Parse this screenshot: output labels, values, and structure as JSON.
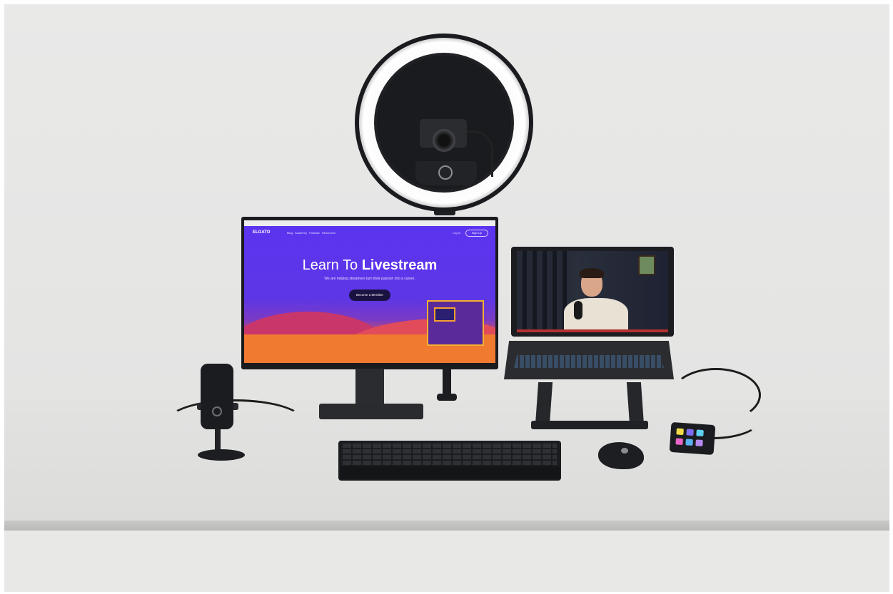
{
  "scene": {
    "description_free": true
  },
  "monitor_site": {
    "logo": "ELGATO",
    "nav": [
      "Blog",
      "Academy",
      "Podcast",
      "Resources"
    ],
    "login": "Log In",
    "signup": "Sign Up",
    "hero_title_plain": "Learn To",
    "hero_title_bold": "Livestream",
    "hero_subtitle": "We are helping streamers turn their passion into a career.",
    "hero_button": "Become a Member"
  },
  "colors": {
    "wall": "#e9e9e8",
    "desk": "#dcdcdb",
    "site_purple": "#5b34f0",
    "site_orange": "#f48b2a"
  },
  "icons": [
    "ring-light",
    "camera",
    "microphone",
    "keyboard",
    "mouse",
    "stream-deck",
    "laptop",
    "monitor"
  ]
}
